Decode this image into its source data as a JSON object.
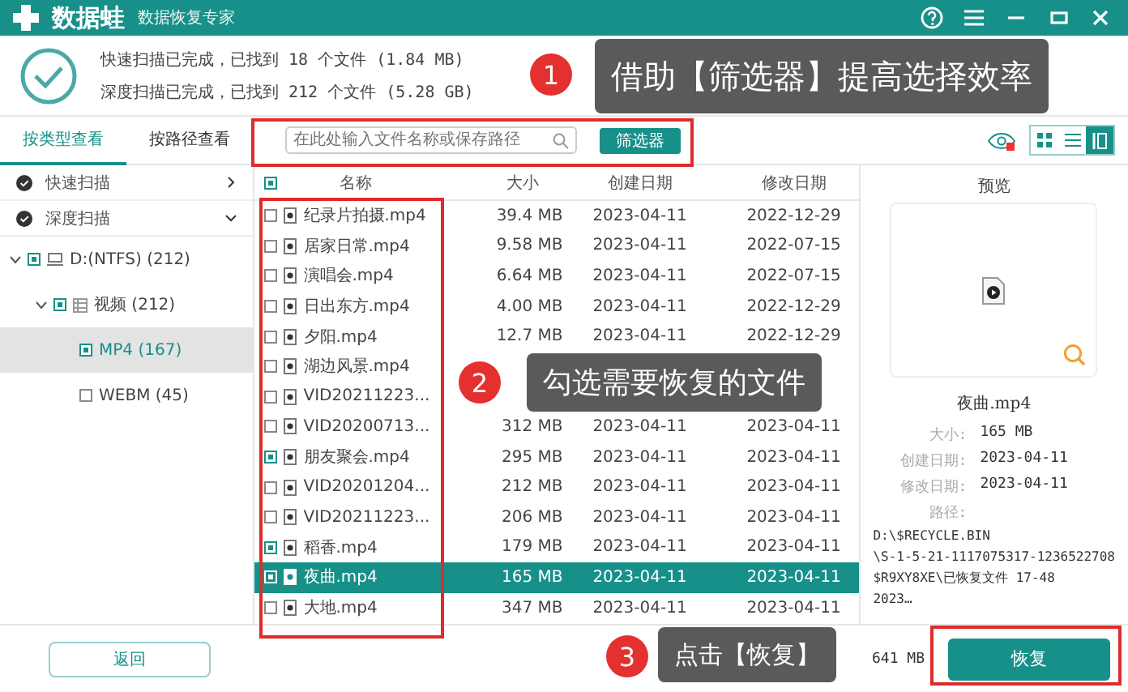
{
  "title_bar": {
    "app_name": "数据蛙",
    "subtitle": "数据恢复专家"
  },
  "scan_summary": [
    "快速扫描已完成，已找到 18 个文件 (1.84 MB)",
    "深度扫描已完成，已找到 212 个文件 (5.28 GB)"
  ],
  "tabs": [
    {
      "label": "按类型查看",
      "selected": true
    },
    {
      "label": "按路径查看",
      "selected": false
    }
  ],
  "search": {
    "placeholder": "在此处输入文件名称或保存路径"
  },
  "filter_button": "筛选器",
  "view_modes": [
    {
      "kind": "grid",
      "selected": false
    },
    {
      "kind": "list",
      "selected": false
    },
    {
      "kind": "detail",
      "selected": true
    }
  ],
  "scans": [
    {
      "label": "快速扫描",
      "expanded": false
    },
    {
      "label": "深度扫描",
      "expanded": true
    }
  ],
  "tree": [
    {
      "label": "D:(NTFS) (212)",
      "kind": "drive",
      "checked": true,
      "selected": false,
      "children": [
        {
          "label": "视频 (212)",
          "kind": "folder",
          "checked": true,
          "selected": false,
          "children": [
            {
              "label": "MP4 (167)",
              "checked": true,
              "selected": true
            },
            {
              "label": "WEBM (45)",
              "checked": false,
              "selected": false
            }
          ]
        }
      ]
    }
  ],
  "table": {
    "header_checked": true,
    "columns": [
      "名称",
      "大小",
      "创建日期",
      "修改日期"
    ],
    "rows": [
      {
        "name": "纪录片拍摄.mp4",
        "size": "39.4 MB",
        "created": "2023-04-11",
        "modified": "2022-12-29",
        "checked": false,
        "selected": false
      },
      {
        "name": "居家日常.mp4",
        "size": "9.58 MB",
        "created": "2023-04-11",
        "modified": "2022-07-15",
        "checked": false,
        "selected": false
      },
      {
        "name": "演唱会.mp4",
        "size": "6.64 MB",
        "created": "2023-04-11",
        "modified": "2022-07-15",
        "checked": false,
        "selected": false
      },
      {
        "name": "日出东方.mp4",
        "size": "4.00 MB",
        "created": "2023-04-11",
        "modified": "2022-12-29",
        "checked": false,
        "selected": false
      },
      {
        "name": "夕阳.mp4",
        "size": "12.7 MB",
        "created": "2023-04-11",
        "modified": "2022-12-29",
        "checked": false,
        "selected": false
      },
      {
        "name": "湖边风景.mp4",
        "size": null,
        "created": null,
        "modified": null,
        "checked": false,
        "selected": false
      },
      {
        "name": "VID20211223...",
        "size": null,
        "created": null,
        "modified": null,
        "checked": false,
        "selected": false
      },
      {
        "name": "VID20200713...",
        "size": "312 MB",
        "created": "2023-04-11",
        "modified": "2023-04-11",
        "checked": false,
        "selected": false
      },
      {
        "name": "朋友聚会.mp4",
        "size": "295 MB",
        "created": "2023-04-11",
        "modified": "2023-04-11",
        "checked": true,
        "selected": false
      },
      {
        "name": "VID20201204...",
        "size": "212 MB",
        "created": "2023-04-11",
        "modified": "2023-04-11",
        "checked": false,
        "selected": false
      },
      {
        "name": "VID20211223...",
        "size": "206 MB",
        "created": "2023-04-11",
        "modified": "2023-04-11",
        "checked": false,
        "selected": false
      },
      {
        "name": "稻香.mp4",
        "size": "179 MB",
        "created": "2023-04-11",
        "modified": "2023-04-11",
        "checked": true,
        "selected": false
      },
      {
        "name": "夜曲.mp4",
        "size": "165 MB",
        "created": "2023-04-11",
        "modified": "2023-04-11",
        "checked": true,
        "selected": true
      },
      {
        "name": "大地.mp4",
        "size": "347 MB",
        "created": "2023-04-11",
        "modified": "2023-04-11",
        "checked": false,
        "selected": false
      }
    ]
  },
  "preview": {
    "title": "预览",
    "file_name": "夜曲.mp4",
    "fields": [
      {
        "label": "大小:",
        "value": "165 MB"
      },
      {
        "label": "创建日期:",
        "value": "2023-04-11"
      },
      {
        "label": "修改日期:",
        "value": "2023-04-11"
      },
      {
        "label": "路径:"
      }
    ],
    "path_lines": [
      "D:\\$RECYCLE.BIN",
      "\\S-1-5-21-1117075317-1236522708",
      "$R9XY8XE\\已恢复文件 17-48",
      "2023…"
    ]
  },
  "back_button": "返回",
  "status": "641 MB",
  "recover_button": "恢复",
  "annotations": [
    {
      "number": "1",
      "text": "借助【筛选器】提高选择效率"
    },
    {
      "number": "2",
      "text": "勾选需要恢复的文件"
    },
    {
      "number": "3",
      "text": "点击【恢复】"
    }
  ]
}
